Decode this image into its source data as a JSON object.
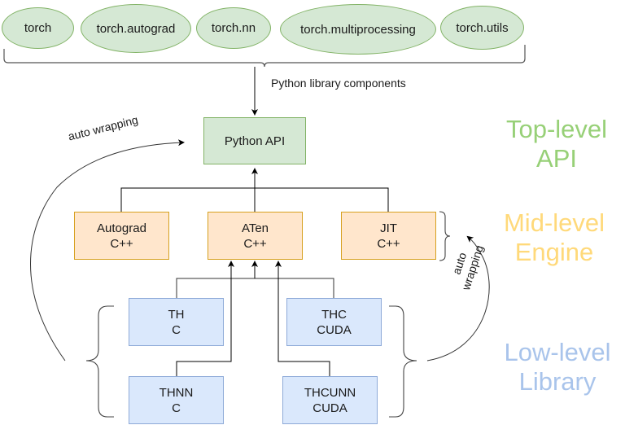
{
  "python_components": {
    "items": [
      {
        "label": "torch"
      },
      {
        "label": "torch.autograd"
      },
      {
        "label": "torch.nn"
      },
      {
        "label": "torch.multiprocessing"
      },
      {
        "label": "torch.utils"
      }
    ],
    "group_label": "Python library components"
  },
  "top": {
    "python_api": {
      "label": "Python API"
    }
  },
  "mid": {
    "autograd": {
      "line1": "Autograd",
      "line2": "C++"
    },
    "aten": {
      "line1": "ATen",
      "line2": "C++"
    },
    "jit": {
      "line1": "JIT",
      "line2": "C++"
    }
  },
  "low": {
    "th": {
      "line1": "TH",
      "line2": "C"
    },
    "thc": {
      "line1": "THC",
      "line2": "CUDA"
    },
    "thnn": {
      "line1": "THNN",
      "line2": "C"
    },
    "thcunn": {
      "line1": "THCUNN",
      "line2": "CUDA"
    }
  },
  "annotations": {
    "auto_wrapping_left": "auto wrapping",
    "auto_wrapping_right_1": "auto",
    "auto_wrapping_right_2": "wrapping"
  },
  "levels": {
    "top": {
      "line1": "Top-level",
      "line2": "API",
      "color": "#97d077"
    },
    "mid": {
      "line1": "Mid-level",
      "line2": "Engine",
      "color": "#ffd97a"
    },
    "low": {
      "line1": "Low-level",
      "line2": "Library",
      "color": "#a9c4eb"
    }
  }
}
